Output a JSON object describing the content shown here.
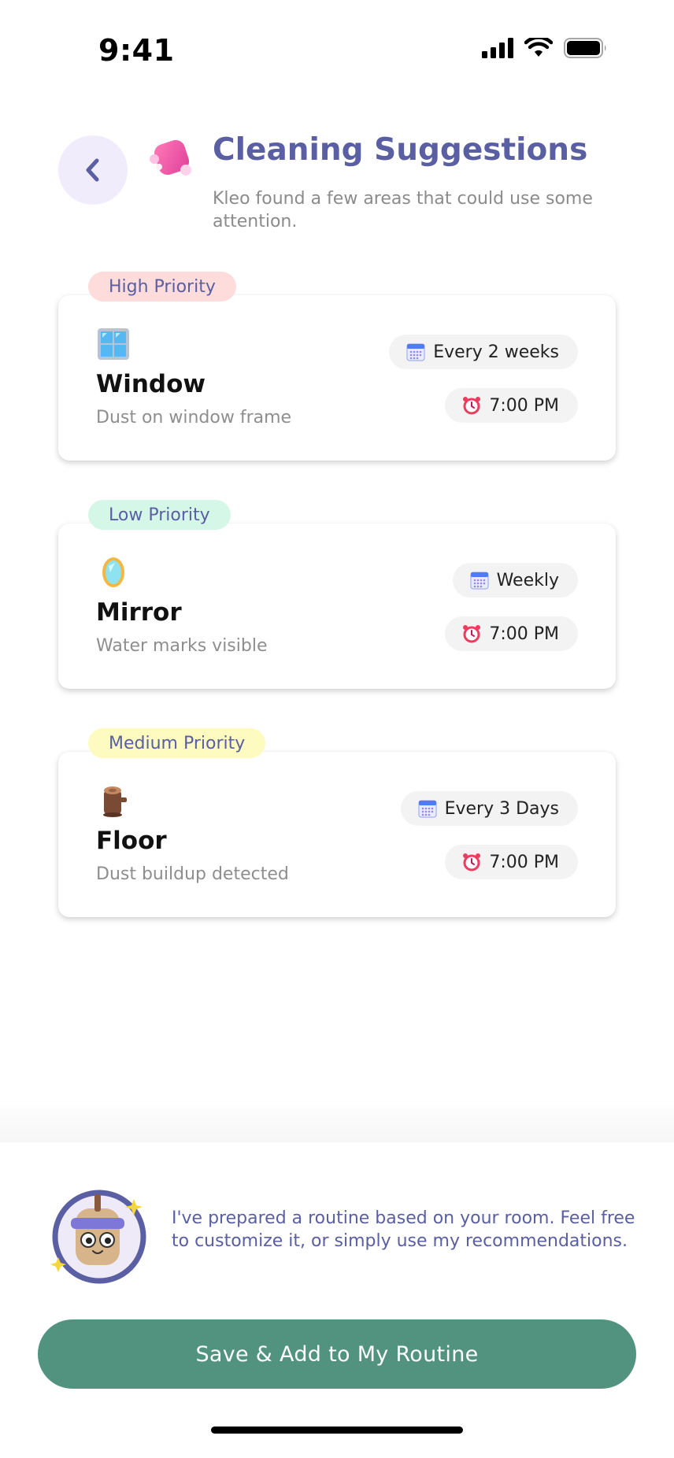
{
  "status_bar": {
    "time": "9:41"
  },
  "header": {
    "title": "Cleaning Suggestions",
    "subtitle": "Kleo found a few areas that could use some attention."
  },
  "suggestions": [
    {
      "priority": "High Priority",
      "priority_color": "#ffdcdc",
      "emoji_icon": "window-icon",
      "title": "Window",
      "description": "Dust on window frame",
      "frequency": "Every 2 weeks",
      "time": "7:00 PM"
    },
    {
      "priority": "Low Priority",
      "priority_color": "#d5f7e8",
      "emoji_icon": "mirror-icon",
      "title": "Mirror",
      "description": "Water marks visible",
      "frequency": "Weekly",
      "time": "7:00 PM"
    },
    {
      "priority": "Medium Priority",
      "priority_color": "#fdfbc0",
      "emoji_icon": "wood-log-icon",
      "title": "Floor",
      "description": "Dust buildup detected",
      "frequency": "Every 3 Days",
      "time": "7:00 PM"
    }
  ],
  "assistant": {
    "message": "I've prepared a routine based on your room. Feel free to customize it, or simply use my recommendations."
  },
  "save_button": {
    "label": "Save & Add to My Routine"
  },
  "colors": {
    "accent": "#5a5ea3",
    "primary_button": "#51937e",
    "back_button_bg": "#f0ecfb"
  }
}
